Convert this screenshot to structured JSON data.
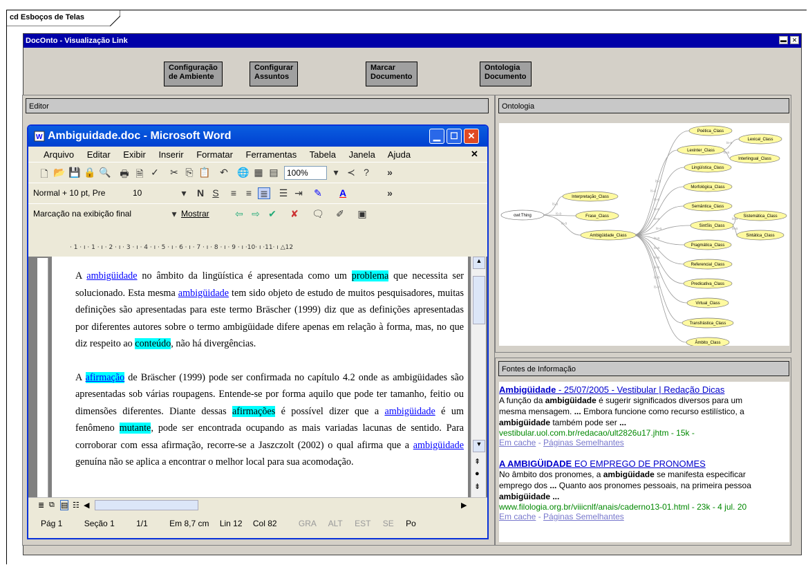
{
  "frame_label": "cd Esboços de Telas",
  "window": {
    "title": "DocOnto - Visualização Link",
    "buttons": [
      "minimize",
      "close"
    ]
  },
  "toolbar": {
    "config_env": "Configuração\nde Ambiente",
    "config_topics": "Configurar\nAssuntos",
    "mark_doc": "Marcar\nDocumento",
    "onto_doc": "Ontologia\nDocumento"
  },
  "editor": {
    "label": "Editor"
  },
  "ontology": {
    "label": "Ontologia",
    "nodes": [
      "Poética_Class",
      "Lexinter_Class",
      "Lexical_Class",
      "Interlingual_Class",
      "Lingüística_Class",
      "Morfológica_Class",
      "Interpretação_Class",
      "Semântica_Class",
      "owl:Thing",
      "Frase_Class",
      "SintSis_Class",
      "Sistemática_Class",
      "Ambigüidade_Class",
      "Sintática_Class",
      "Pragmática_Class",
      "Referencial_Class",
      "Predicativa_Class",
      "Virtual_Class",
      "Transfrástica_Class",
      "Âmbito_Class"
    ],
    "edge_label": "is-a"
  },
  "sources": {
    "label": "Fontes de Informação",
    "results": [
      {
        "title_bold": "Ambigüidade",
        "title_rest": " - 25/07/2005 - Vestibular | Redação Dicas",
        "snippet": [
          "A função da <b>ambigüidade</b> é sugerir significados diversos para um",
          "mesma mensagem. <b>...</b> Embora funcione como recurso estilístico, a",
          "<b>ambigüidade</b> também pode ser <b>...</b>"
        ],
        "url": "vestibular.uol.com.br/redacao/ult2826u17.jhtm - 15k -",
        "cache": "Em cache",
        "similar": "Páginas Semelhantes"
      },
      {
        "title_bold": "A AMBIGÜIDADE",
        "title_rest": " EO EMPREGO DE PRONOMES",
        "snippet": [
          "No âmbito dos pronomes, a <b>ambigüidade</b> se manifesta especificar",
          "emprego dos <b>...</b> Quanto aos pronomes pessoais, na primeira pessoa",
          "<b>ambigüidade ...</b>"
        ],
        "url": "www.filologia.org.br/viiicnlf/anais/caderno13-01.html - 23k - 4 jul. 20",
        "cache": "Em cache",
        "similar": "Páginas Semelhantes"
      }
    ]
  },
  "word": {
    "title": "Ambiguidade.doc - Microsoft Word",
    "menu": [
      "Arquivo",
      "Editar",
      "Exibir",
      "Inserir",
      "Formatar",
      "Ferramentas",
      "Tabela",
      "Janela",
      "Ajuda"
    ],
    "zoom": "100%",
    "style": "Normal + 10 pt, Pre",
    "font_size": "10",
    "bold_btn": "N",
    "underline_btn": "S",
    "markup": "Marcação na exibição final",
    "show": "Mostrar",
    "ruler": "· 1 · ı · 1 · ı · 2 · ı · 3 · ı · 4 · ı · 5 · ı · 6 · ı · 7 · ı · 8 · ı · 9 · ı ·10· ı ·11· ı △12",
    "status": {
      "page": "Pág 1",
      "section": "Seção 1",
      "pages": "1/1",
      "at": "Em 8,7 cm",
      "line": "Lin 12",
      "col": "Col 82",
      "flags": [
        "GRA",
        "ALT",
        "EST",
        "SE",
        "Po"
      ]
    }
  },
  "document": {
    "p1": [
      {
        "t": "A "
      },
      {
        "t": "ambigüidade",
        "c": "lnk"
      },
      {
        "t": " no âmbito da lingüística é apresentada como um "
      },
      {
        "t": "problema",
        "c": "hl"
      },
      {
        "t": " que necessita ser solucionado. Esta mesma "
      },
      {
        "t": "ambigüidade",
        "c": "lnk"
      },
      {
        "t": " tem sido objeto de estudo de muitos pesquisadores, muitas definições são apresentadas para este termo Bräscher (1999) diz que as definições apresentadas por diferentes autores sobre o termo ambigüidade difere apenas em relação à forma, mas, no que diz respeito ao "
      },
      {
        "t": "conteúdo",
        "c": "hl"
      },
      {
        "t": ", não há divergências."
      }
    ],
    "p2": [
      {
        "t": "A "
      },
      {
        "t": "afirmação",
        "c": "hl lnk"
      },
      {
        "t": " de Bräscher (1999) pode ser confirmada no capítulo 4.2 onde as ambigüidades são apresentadas sob várias roupagens. Entende-se por forma aquilo que pode ter tamanho, feitio ou dimensões diferentes. Diante dessas "
      },
      {
        "t": "afirmações",
        "c": "hl"
      },
      {
        "t": " é possível dizer que a "
      },
      {
        "t": "ambigüidade",
        "c": "lnk"
      },
      {
        "t": " é um fenômeno "
      },
      {
        "t": "mutante",
        "c": "hl"
      },
      {
        "t": ", pode ser encontrada ocupando as mais variadas lacunas de sentido. Para corroborar com essa afirmação, recorre-se a Jaszczolt (2002) o qual afirma que a "
      },
      {
        "t": "ambigüidade",
        "c": "lnk"
      },
      {
        "t": " genuína não se aplica a encontrar o melhor local para sua acomodação."
      }
    ]
  }
}
